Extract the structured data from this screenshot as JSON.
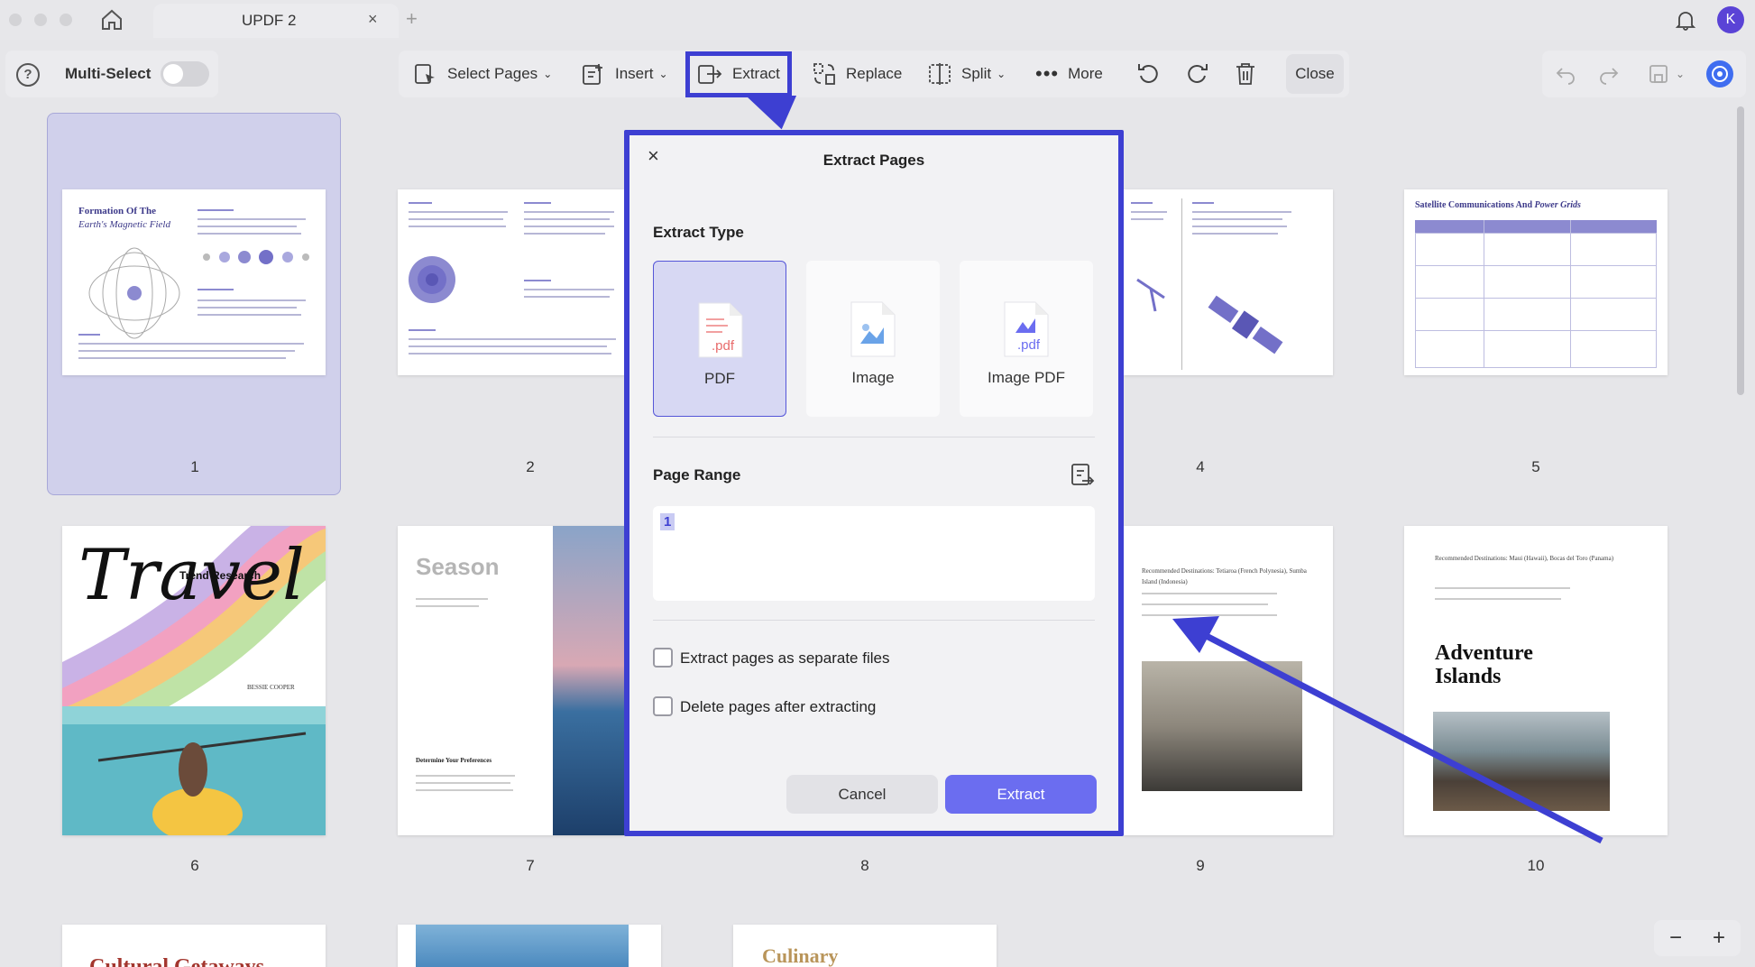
{
  "tab": {
    "title": "UPDF 2",
    "close": "×",
    "new": "+"
  },
  "user": {
    "initial": "K"
  },
  "toolbar": {
    "help": "?",
    "multi_select": "Multi-Select",
    "select_pages": "Select Pages",
    "insert": "Insert",
    "extract": "Extract",
    "replace": "Replace",
    "split": "Split",
    "more": "More",
    "close": "Close"
  },
  "pages": [
    {
      "num": "1",
      "title": "Formation Of The",
      "subtitle": "Earth's Magnetic Field"
    },
    {
      "num": "2"
    },
    {
      "num": "4"
    },
    {
      "num": "5",
      "title": "Satellite Communications And",
      "title_em": "Power Grids"
    },
    {
      "num": "6",
      "title": "Travel",
      "tag": "Trend Research",
      "author": "BESSIE COOPER"
    },
    {
      "num": "7",
      "title": "Season",
      "caption": "Determine Your Preferences"
    },
    {
      "num": "8"
    },
    {
      "num": "9",
      "text": "Recommended Destinations: Tetiaroa (French Polynesia), Sumba Island (Indonesia)"
    },
    {
      "num": "10",
      "title": "Adventure",
      "title2": "Islands",
      "text": "Recommended Destinations: Maui (Hawaii), Bocas del Toro (Panama)"
    },
    {
      "num": "",
      "title": "Cultural Getaways"
    },
    {
      "num": "",
      "title": "Culinary"
    }
  ],
  "dialog": {
    "title": "Extract Pages",
    "close": "×",
    "extract_type_label": "Extract Type",
    "types": [
      {
        "name": "PDF",
        "ext": ".pdf"
      },
      {
        "name": "Image"
      },
      {
        "name": "Image PDF",
        "ext": ".pdf"
      }
    ],
    "page_range_label": "Page Range",
    "page_range_value": "1",
    "option_separate": "Extract pages as separate files",
    "option_delete": "Delete pages after extracting",
    "cancel": "Cancel",
    "extract": "Extract"
  },
  "zoom": {
    "out": "−",
    "in": "+"
  },
  "colors": {
    "accent": "#3d3fd2",
    "button": "#6b6df0",
    "selected": "#d0d0eb"
  }
}
